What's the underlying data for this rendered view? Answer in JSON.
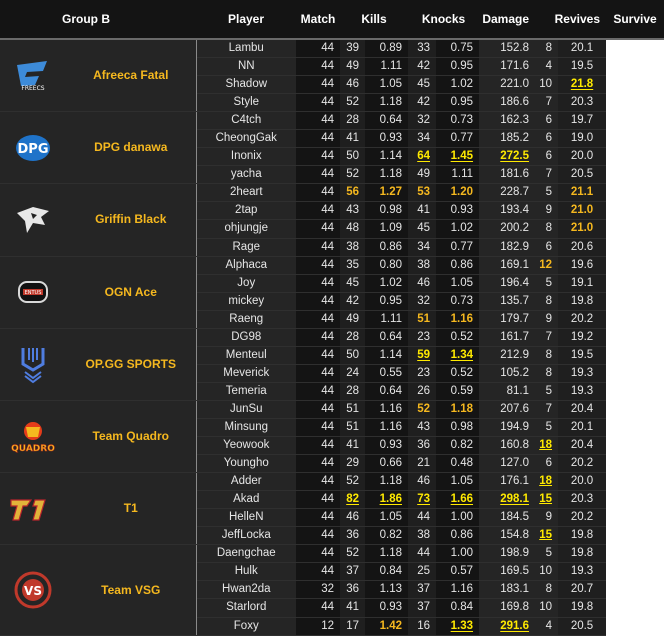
{
  "colors": {
    "background": "#141414",
    "panel": "#252525",
    "gold": "#f5b81f",
    "best": "#ffea00",
    "text": "#e6e6e6"
  },
  "headers": {
    "group": "Group B",
    "player": "Player",
    "match": "Match",
    "kills": "Kills",
    "knocks": "Knocks",
    "damage": "Damage",
    "revives": "Revives",
    "survive": "Survive"
  },
  "teams": [
    {
      "name": "Afreeca Fatal",
      "logo": "afreeca-freecs-logo",
      "players": [
        {
          "name": "Lambu",
          "match": "44",
          "kills": "39",
          "kpg": "0.89",
          "knocks": "33",
          "knpg": "0.75",
          "damage": "152.8",
          "dpg": "8",
          "revives": "20.1",
          "survive": ""
        },
        {
          "name": "NN",
          "match": "44",
          "kills": "49",
          "kpg": "1.11",
          "knocks": "42",
          "knpg": "0.95",
          "damage": "171.6",
          "dpg": "4",
          "revives": "19.5",
          "survive": ""
        },
        {
          "name": "Shadow",
          "match": "44",
          "kills": "46",
          "kpg": "1.05",
          "knocks": "45",
          "knpg": "1.02",
          "damage": "221.0",
          "dpg": "10",
          "revives": "21.8",
          "survive": ""
        },
        {
          "name": "Style",
          "match": "44",
          "kills": "52",
          "kpg": "1.18",
          "knocks": "42",
          "knpg": "0.95",
          "damage": "186.6",
          "dpg": "7",
          "revives": "20.3",
          "survive": ""
        }
      ]
    },
    {
      "name": "DPG danawa",
      "logo": "dpg-logo",
      "players": [
        {
          "name": "C4tch",
          "match": "44",
          "kills": "28",
          "kpg": "0.64",
          "knocks": "32",
          "knpg": "0.73",
          "damage": "162.3",
          "dpg": "6",
          "revives": "19.7",
          "survive": ""
        },
        {
          "name": "CheongGak",
          "match": "44",
          "kills": "41",
          "kpg": "0.93",
          "knocks": "34",
          "knpg": "0.77",
          "damage": "185.2",
          "dpg": "6",
          "revives": "19.0",
          "survive": ""
        },
        {
          "name": "Inonix",
          "match": "44",
          "kills": "50",
          "kpg": "1.14",
          "knocks": "64",
          "knpg": "1.45",
          "damage": "272.5",
          "dpg": "6",
          "revives": "20.0",
          "survive": ""
        },
        {
          "name": "yacha",
          "match": "44",
          "kills": "52",
          "kpg": "1.18",
          "knocks": "49",
          "knpg": "1.11",
          "damage": "181.6",
          "dpg": "7",
          "revives": "20.5",
          "survive": ""
        }
      ]
    },
    {
      "name": "Griffin Black",
      "logo": "griffin-logo",
      "players": [
        {
          "name": "2heart",
          "match": "44",
          "kills": "56",
          "kpg": "1.27",
          "knocks": "53",
          "knpg": "1.20",
          "damage": "228.7",
          "dpg": "5",
          "revives": "21.1",
          "survive": ""
        },
        {
          "name": "2tap",
          "match": "44",
          "kills": "43",
          "kpg": "0.98",
          "knocks": "41",
          "knpg": "0.93",
          "damage": "193.4",
          "dpg": "9",
          "revives": "21.0",
          "survive": ""
        },
        {
          "name": "ohjungje",
          "match": "44",
          "kills": "48",
          "kpg": "1.09",
          "knocks": "45",
          "knpg": "1.02",
          "damage": "200.2",
          "dpg": "8",
          "revives": "21.0",
          "survive": ""
        },
        {
          "name": "Rage",
          "match": "44",
          "kills": "38",
          "kpg": "0.86",
          "knocks": "34",
          "knpg": "0.77",
          "damage": "182.9",
          "dpg": "6",
          "revives": "20.6",
          "survive": ""
        }
      ]
    },
    {
      "name": "OGN Ace",
      "logo": "ogn-entus-logo",
      "players": [
        {
          "name": "Alphaca",
          "match": "44",
          "kills": "35",
          "kpg": "0.80",
          "knocks": "38",
          "knpg": "0.86",
          "damage": "169.1",
          "dpg": "12",
          "revives": "19.6",
          "survive": ""
        },
        {
          "name": "Joy",
          "match": "44",
          "kills": "45",
          "kpg": "1.02",
          "knocks": "46",
          "knpg": "1.05",
          "damage": "196.4",
          "dpg": "5",
          "revives": "19.1",
          "survive": ""
        },
        {
          "name": "mickey",
          "match": "44",
          "kills": "42",
          "kpg": "0.95",
          "knocks": "32",
          "knpg": "0.73",
          "damage": "135.7",
          "dpg": "8",
          "revives": "19.8",
          "survive": ""
        },
        {
          "name": "Raeng",
          "match": "44",
          "kills": "49",
          "kpg": "1.11",
          "knocks": "51",
          "knpg": "1.16",
          "damage": "179.7",
          "dpg": "9",
          "revives": "20.2",
          "survive": ""
        }
      ]
    },
    {
      "name": "OP.GG SPORTS",
      "logo": "opgg-logo",
      "players": [
        {
          "name": "DG98",
          "match": "44",
          "kills": "28",
          "kpg": "0.64",
          "knocks": "23",
          "knpg": "0.52",
          "damage": "161.7",
          "dpg": "7",
          "revives": "19.2",
          "survive": ""
        },
        {
          "name": "Menteul",
          "match": "44",
          "kills": "50",
          "kpg": "1.14",
          "knocks": "59",
          "knpg": "1.34",
          "damage": "212.9",
          "dpg": "8",
          "revives": "19.5",
          "survive": ""
        },
        {
          "name": "Meverick",
          "match": "44",
          "kills": "24",
          "kpg": "0.55",
          "knocks": "23",
          "knpg": "0.52",
          "damage": "105.2",
          "dpg": "8",
          "revives": "19.3",
          "survive": ""
        },
        {
          "name": "Temeria",
          "match": "44",
          "kills": "28",
          "kpg": "0.64",
          "knocks": "26",
          "knpg": "0.59",
          "damage": "81.1",
          "dpg": "5",
          "revives": "19.3",
          "survive": ""
        }
      ]
    },
    {
      "name": "Team Quadro",
      "logo": "quadro-logo",
      "players": [
        {
          "name": "JunSu",
          "match": "44",
          "kills": "51",
          "kpg": "1.16",
          "knocks": "52",
          "knpg": "1.18",
          "damage": "207.6",
          "dpg": "7",
          "revives": "20.4",
          "survive": ""
        },
        {
          "name": "Minsung",
          "match": "44",
          "kills": "51",
          "kpg": "1.16",
          "knocks": "43",
          "knpg": "0.98",
          "damage": "194.9",
          "dpg": "5",
          "revives": "20.1",
          "survive": ""
        },
        {
          "name": "Yeowook",
          "match": "44",
          "kills": "41",
          "kpg": "0.93",
          "knocks": "36",
          "knpg": "0.82",
          "damage": "160.8",
          "dpg": "18",
          "revives": "20.4",
          "survive": ""
        },
        {
          "name": "Youngho",
          "match": "44",
          "kills": "29",
          "kpg": "0.66",
          "knocks": "21",
          "knpg": "0.48",
          "damage": "127.0",
          "dpg": "6",
          "revives": "20.2",
          "survive": ""
        }
      ]
    },
    {
      "name": "T1",
      "logo": "t1-logo",
      "players": [
        {
          "name": "Adder",
          "match": "44",
          "kills": "52",
          "kpg": "1.18",
          "knocks": "46",
          "knpg": "1.05",
          "damage": "176.1",
          "dpg": "18",
          "revives": "20.0",
          "survive": ""
        },
        {
          "name": "Akad",
          "match": "44",
          "kills": "82",
          "kpg": "1.86",
          "knocks": "73",
          "knpg": "1.66",
          "damage": "298.1",
          "dpg": "15",
          "revives": "20.3",
          "survive": ""
        },
        {
          "name": "HelleN",
          "match": "44",
          "kills": "46",
          "kpg": "1.05",
          "knocks": "44",
          "knpg": "1.00",
          "damage": "184.5",
          "dpg": "9",
          "revives": "20.2",
          "survive": ""
        },
        {
          "name": "JeffLocka",
          "match": "44",
          "kills": "36",
          "kpg": "0.82",
          "knocks": "38",
          "knpg": "0.86",
          "damage": "154.8",
          "dpg": "15",
          "revives": "19.8",
          "survive": ""
        }
      ]
    },
    {
      "name": "Team VSG",
      "logo": "vsg-logo",
      "players": [
        {
          "name": "Daengchae",
          "match": "44",
          "kills": "52",
          "kpg": "1.18",
          "knocks": "44",
          "knpg": "1.00",
          "damage": "198.9",
          "dpg": "5",
          "revives": "19.8",
          "survive": ""
        },
        {
          "name": "Hulk",
          "match": "44",
          "kills": "37",
          "kpg": "0.84",
          "knocks": "25",
          "knpg": "0.57",
          "damage": "169.5",
          "dpg": "10",
          "revives": "19.3",
          "survive": ""
        },
        {
          "name": "Hwan2da",
          "match": "32",
          "kills": "36",
          "kpg": "1.13",
          "knocks": "37",
          "knpg": "1.16",
          "damage": "183.1",
          "dpg": "8",
          "revives": "20.7",
          "survive": ""
        },
        {
          "name": "Starlord",
          "match": "44",
          "kills": "41",
          "kpg": "0.93",
          "knocks": "37",
          "knpg": "0.84",
          "damage": "169.8",
          "dpg": "10",
          "revives": "19.8",
          "survive": ""
        },
        {
          "name": "Foxy",
          "match": "12",
          "kills": "17",
          "kpg": "1.42",
          "knocks": "16",
          "knpg": "1.33",
          "damage": "291.6",
          "dpg": "4",
          "revives": "20.5",
          "survive": ""
        }
      ]
    }
  ]
}
